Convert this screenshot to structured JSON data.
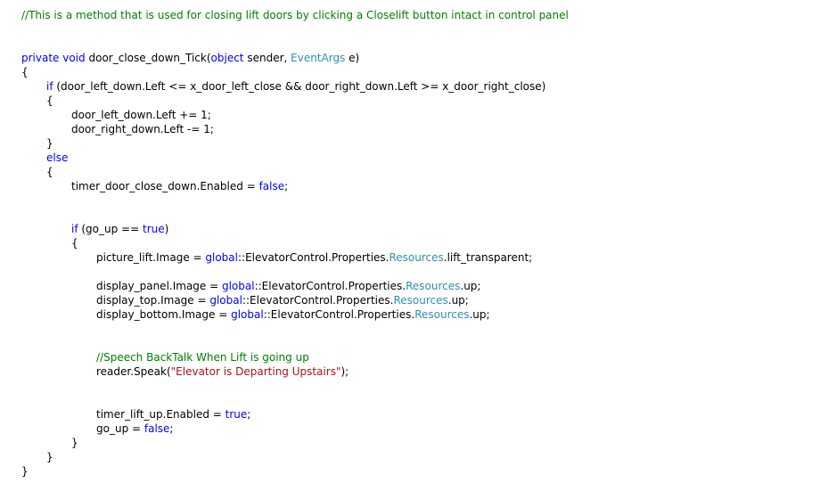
{
  "colors": {
    "background": "#ffffff",
    "plain": "#000000",
    "keyword": "#0000ff",
    "comment": "#008000",
    "type": "#2b91af",
    "string": "#a31515"
  },
  "editor": {
    "lines": [
      {
        "indent": 24,
        "tokens": [
          {
            "k": "cm",
            "t": "//This is a method that is used for closing lift doors by clicking a Closelift button intact in control panel"
          }
        ]
      },
      {
        "indent": 0,
        "tokens": []
      },
      {
        "indent": 0,
        "tokens": []
      },
      {
        "indent": 24,
        "tokens": [
          {
            "k": "kw",
            "t": "private"
          },
          {
            "k": "pl",
            "t": " "
          },
          {
            "k": "kw",
            "t": "void"
          },
          {
            "k": "pl",
            "t": " door_close_down_Tick("
          },
          {
            "k": "kw",
            "t": "object"
          },
          {
            "k": "pl",
            "t": " sender, "
          },
          {
            "k": "ty",
            "t": "EventArgs"
          },
          {
            "k": "pl",
            "t": " e)"
          }
        ]
      },
      {
        "indent": 24,
        "tokens": [
          {
            "k": "pl",
            "t": "{"
          }
        ]
      },
      {
        "indent": 52,
        "tokens": [
          {
            "k": "kw",
            "t": "if"
          },
          {
            "k": "pl",
            "t": " (door_left_down.Left <= x_door_left_close && door_right_down.Left >= x_door_right_close)"
          }
        ]
      },
      {
        "indent": 52,
        "tokens": [
          {
            "k": "pl",
            "t": "{"
          }
        ]
      },
      {
        "indent": 80,
        "tokens": [
          {
            "k": "pl",
            "t": "door_left_down.Left += 1;"
          }
        ]
      },
      {
        "indent": 80,
        "tokens": [
          {
            "k": "pl",
            "t": "door_right_down.Left -= 1;"
          }
        ]
      },
      {
        "indent": 52,
        "tokens": [
          {
            "k": "pl",
            "t": "}"
          }
        ]
      },
      {
        "indent": 52,
        "tokens": [
          {
            "k": "kw",
            "t": "else"
          }
        ]
      },
      {
        "indent": 52,
        "tokens": [
          {
            "k": "pl",
            "t": "{"
          }
        ]
      },
      {
        "indent": 80,
        "tokens": [
          {
            "k": "pl",
            "t": "timer_door_close_down.Enabled = "
          },
          {
            "k": "kw",
            "t": "false"
          },
          {
            "k": "pl",
            "t": ";"
          }
        ]
      },
      {
        "indent": 0,
        "tokens": []
      },
      {
        "indent": 0,
        "tokens": []
      },
      {
        "indent": 80,
        "tokens": [
          {
            "k": "kw",
            "t": "if"
          },
          {
            "k": "pl",
            "t": " (go_up == "
          },
          {
            "k": "kw",
            "t": "true"
          },
          {
            "k": "pl",
            "t": ")"
          }
        ]
      },
      {
        "indent": 80,
        "tokens": [
          {
            "k": "pl",
            "t": "{"
          }
        ]
      },
      {
        "indent": 108,
        "tokens": [
          {
            "k": "pl",
            "t": "picture_lift.Image = "
          },
          {
            "k": "kw",
            "t": "global"
          },
          {
            "k": "pl",
            "t": "::ElevatorControl.Properties."
          },
          {
            "k": "ty",
            "t": "Resources"
          },
          {
            "k": "pl",
            "t": ".lift_transparent;"
          }
        ]
      },
      {
        "indent": 0,
        "tokens": []
      },
      {
        "indent": 108,
        "tokens": [
          {
            "k": "pl",
            "t": "display_panel.Image = "
          },
          {
            "k": "kw",
            "t": "global"
          },
          {
            "k": "pl",
            "t": "::ElevatorControl.Properties."
          },
          {
            "k": "ty",
            "t": "Resources"
          },
          {
            "k": "pl",
            "t": ".up;"
          }
        ]
      },
      {
        "indent": 108,
        "tokens": [
          {
            "k": "pl",
            "t": "display_top.Image = "
          },
          {
            "k": "kw",
            "t": "global"
          },
          {
            "k": "pl",
            "t": "::ElevatorControl.Properties."
          },
          {
            "k": "ty",
            "t": "Resources"
          },
          {
            "k": "pl",
            "t": ".up;"
          }
        ]
      },
      {
        "indent": 108,
        "tokens": [
          {
            "k": "pl",
            "t": "display_bottom.Image = "
          },
          {
            "k": "kw",
            "t": "global"
          },
          {
            "k": "pl",
            "t": "::ElevatorControl.Properties."
          },
          {
            "k": "ty",
            "t": "Resources"
          },
          {
            "k": "pl",
            "t": ".up;"
          }
        ]
      },
      {
        "indent": 0,
        "tokens": []
      },
      {
        "indent": 0,
        "tokens": []
      },
      {
        "indent": 108,
        "tokens": [
          {
            "k": "cm",
            "t": "//Speech BackTalk When Lift is going up"
          }
        ]
      },
      {
        "indent": 108,
        "tokens": [
          {
            "k": "pl",
            "t": "reader.Speak("
          },
          {
            "k": "st",
            "t": "\"Elevator is Departing Upstairs\""
          },
          {
            "k": "pl",
            "t": ");"
          }
        ]
      },
      {
        "indent": 0,
        "tokens": []
      },
      {
        "indent": 0,
        "tokens": []
      },
      {
        "indent": 108,
        "tokens": [
          {
            "k": "pl",
            "t": "timer_lift_up.Enabled = "
          },
          {
            "k": "kw",
            "t": "true"
          },
          {
            "k": "pl",
            "t": ";"
          }
        ]
      },
      {
        "indent": 108,
        "tokens": [
          {
            "k": "pl",
            "t": "go_up = "
          },
          {
            "k": "kw",
            "t": "false"
          },
          {
            "k": "pl",
            "t": ";"
          }
        ]
      },
      {
        "indent": 80,
        "tokens": [
          {
            "k": "pl",
            "t": "}"
          }
        ]
      },
      {
        "indent": 52,
        "tokens": [
          {
            "k": "pl",
            "t": "}"
          }
        ]
      },
      {
        "indent": 24,
        "tokens": [
          {
            "k": "pl",
            "t": "}"
          }
        ]
      }
    ]
  }
}
